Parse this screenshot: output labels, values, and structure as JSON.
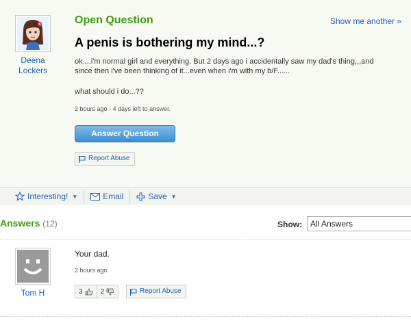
{
  "question": {
    "header_label": "Open Question",
    "show_another": "Show me another »",
    "title": "A penis is bothering my mind...?",
    "body": "ok....i'm normal girl and everything. But 2 days ago i accidentally saw my dad's thing,,,and since then i've been thinking of it...even when i'm with my b/F......",
    "followup": "what should i do...??",
    "meta": "2 hours ago - 4 days left to answer.",
    "answer_button": "Answer Question",
    "report_abuse": "Report Abuse",
    "user": {
      "name": "Deena Lockers",
      "avatar_icon": "girl-avatar-icon"
    }
  },
  "toolbar": {
    "interesting": "Interesting!",
    "email": "Email",
    "save": "Save"
  },
  "answers": {
    "heading": "Answers",
    "count": "(12)",
    "show_label": "Show:",
    "show_value": "All Answers",
    "items": [
      {
        "user": "Tom H",
        "avatar_icon": "default-smiley-avatar-icon",
        "text": "Your dad.",
        "meta": "2 hours ago",
        "thumbs_up": "3",
        "thumbs_down": "2",
        "report_abuse": "Report Abuse"
      }
    ]
  },
  "colors": {
    "accent_green": "#3c9c12",
    "link_blue": "#1c63b8",
    "button_blue": "#3d8fd2",
    "panel_bg": "#f7faf2"
  }
}
